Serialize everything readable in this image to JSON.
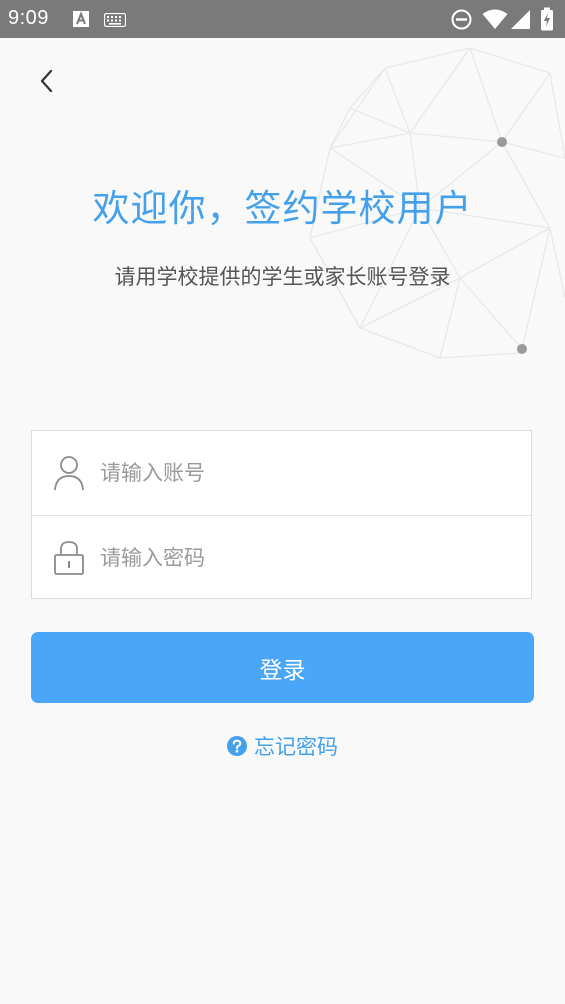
{
  "status_bar": {
    "time": "9:09",
    "icons": [
      "text-notification-icon",
      "keyboard-icon",
      "do-not-disturb-icon",
      "wifi-icon",
      "signal-icon",
      "battery-charging-icon"
    ]
  },
  "header": {
    "back_icon": "chevron-left-icon"
  },
  "welcome": {
    "title": "欢迎你，签约学校用户",
    "subtitle": "请用学校提供的学生或家长账号登录"
  },
  "form": {
    "account": {
      "icon": "user-icon",
      "value": "",
      "placeholder": "请输入账号"
    },
    "password": {
      "icon": "lock-icon",
      "value": "",
      "placeholder": "请输入密码"
    },
    "login_label": "登录",
    "forgot_label": "忘记密码",
    "forgot_icon": "question-circle-icon"
  },
  "colors": {
    "accent": "#45a0ec",
    "button": "#4aa6f8",
    "status_bar": "#7a7a7a",
    "background": "#f9f9f9"
  }
}
